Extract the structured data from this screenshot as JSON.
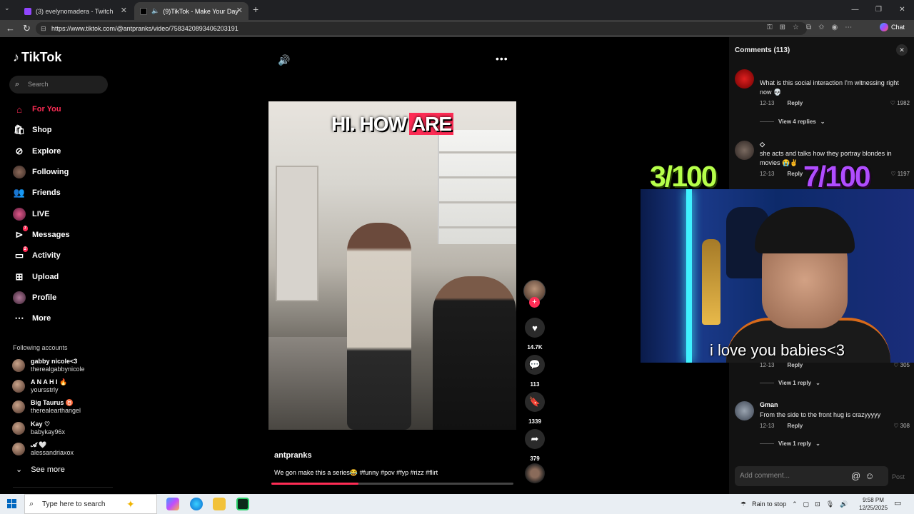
{
  "browser": {
    "tabs": [
      {
        "title": "(3) evelynomadera - Twitch"
      },
      {
        "title": "(9)TikTok - Make Your Day"
      }
    ],
    "url": "https://www.tiktok.com/@antpranks/video/7583420893406203191",
    "chat_label": "Chat"
  },
  "sidebar": {
    "brand": "TikTok",
    "search_placeholder": "Search",
    "nav": [
      {
        "label": "For You",
        "icon": "home-icon",
        "active": true
      },
      {
        "label": "Shop",
        "icon": "shop-icon"
      },
      {
        "label": "Explore",
        "icon": "compass-icon"
      },
      {
        "label": "Following",
        "icon": "avatar"
      },
      {
        "label": "Friends",
        "icon": "friends-icon"
      },
      {
        "label": "LIVE",
        "icon": "live-icon"
      },
      {
        "label": "Messages",
        "icon": "messages-icon",
        "badge": "7"
      },
      {
        "label": "Activity",
        "icon": "activity-icon",
        "badge": "2"
      },
      {
        "label": "Upload",
        "icon": "upload-icon"
      },
      {
        "label": "Profile",
        "icon": "profile-icon"
      },
      {
        "label": "More",
        "icon": "more-icon"
      }
    ],
    "following_title": "Following accounts",
    "following": [
      {
        "name": "gabby nicole<3",
        "handle": "therealgabbynicole"
      },
      {
        "name": "A N A H I 🔥",
        "handle": "yoursstrly"
      },
      {
        "name": "Big Taurus ♉",
        "handle": "therealearthangel"
      },
      {
        "name": "Kay ♡",
        "handle": "babykay96x"
      },
      {
        "name": "𝓐 🤍",
        "handle": "alessandriaxox"
      }
    ],
    "see_more": "See more"
  },
  "video": {
    "caption_part1": "HI. HOW",
    "caption_part2": "ARE",
    "author": "antpranks",
    "description": "We gon make this a series😂 #funny #pov #fyp #rizz #flirt",
    "progress": 0.36,
    "likes": "14.7K",
    "comments": "113",
    "saves": "1339",
    "shares": "379"
  },
  "comments": {
    "title": "Comments (113)",
    "items": [
      {
        "text": "What is this social interaction I'm witnessing right now 💀",
        "date": "12-13",
        "reply": "Reply",
        "likes": "1982",
        "view_replies": "View 4 replies"
      },
      {
        "user": "◇",
        "text": "she acts and talks how they portray blondes in movies 😭✌️",
        "date": "12-13",
        "reply": "Reply",
        "likes": "1197"
      },
      {
        "date": "12-13",
        "reply": "Reply",
        "likes": "305",
        "view_replies": "View 1 reply"
      },
      {
        "user": "Gman",
        "text": "From the side to the front hug is crazyyyyy",
        "date": "12-13",
        "reply": "Reply",
        "likes": "308",
        "view_replies": "View 1 reply"
      }
    ],
    "add_placeholder": "Add comment...",
    "post_label": "Post"
  },
  "stream_overlay": {
    "counter_left": "3/100",
    "counter_right": "7/100",
    "webcam_caption": "i love you babies<3"
  },
  "taskbar": {
    "search_placeholder": "Type here to search",
    "weather": "Rain to stop",
    "time": "9:58 PM",
    "date": "12/25/2025"
  }
}
